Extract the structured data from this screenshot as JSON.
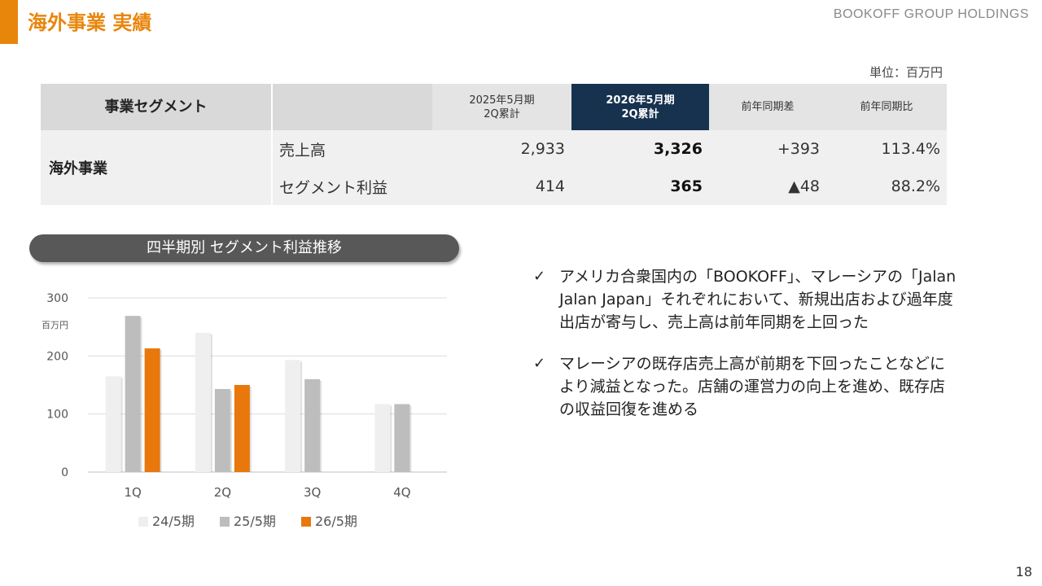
{
  "header": {
    "title": "海外事業 実績",
    "brand": "BOOKOFF GROUP HOLDINGS"
  },
  "table": {
    "unit": "単位：百万円",
    "headers": [
      "事業セグメント",
      "",
      "2025年5月期\n2Q累計",
      "2026年5月期\n2Q累計",
      "前年同期差",
      "前年同期比"
    ],
    "segment": "海外事業",
    "rows": [
      {
        "label": "売上高",
        "prev": "2,933",
        "curr": "3,326",
        "diff": "+393",
        "ratio": "113.4%"
      },
      {
        "label": "セグメント利益",
        "prev": "414",
        "curr": "365",
        "diff": "▲48",
        "ratio": "88.2%"
      }
    ]
  },
  "chart_title": "四半期別 セグメント利益推移",
  "chart_data": {
    "type": "bar",
    "categories": [
      "1Q",
      "2Q",
      "3Q",
      "4Q"
    ],
    "series": [
      {
        "name": "24/5期",
        "color": "#efefef",
        "values": [
          165,
          240,
          193,
          117
        ]
      },
      {
        "name": "25/5期",
        "color": "#bdbdbd",
        "values": [
          269,
          143,
          160,
          117
        ]
      },
      {
        "name": "26/5期",
        "color": "#E8770C",
        "values": [
          213,
          150,
          null,
          null
        ]
      }
    ],
    "ylim": [
      0,
      300
    ],
    "yticks": [
      "0",
      "100",
      "200",
      "300"
    ],
    "ylabel": "百万円",
    "grid": true,
    "legend": "bottom"
  },
  "bullets": [
    "アメリカ合衆国内の「BOOKOFF」、マレーシアの「Jalan Jalan Japan」それぞれにおいて、新規出店および過年度出店が寄与し、売上高は前年同期を上回った",
    "マレーシアの既存店売上高が前期を下回ったことなどにより減益となった。店舗の運営力の向上を進め、既存店の収益回復を進める"
  ],
  "bullet_mark": "✓",
  "page_number": "18"
}
